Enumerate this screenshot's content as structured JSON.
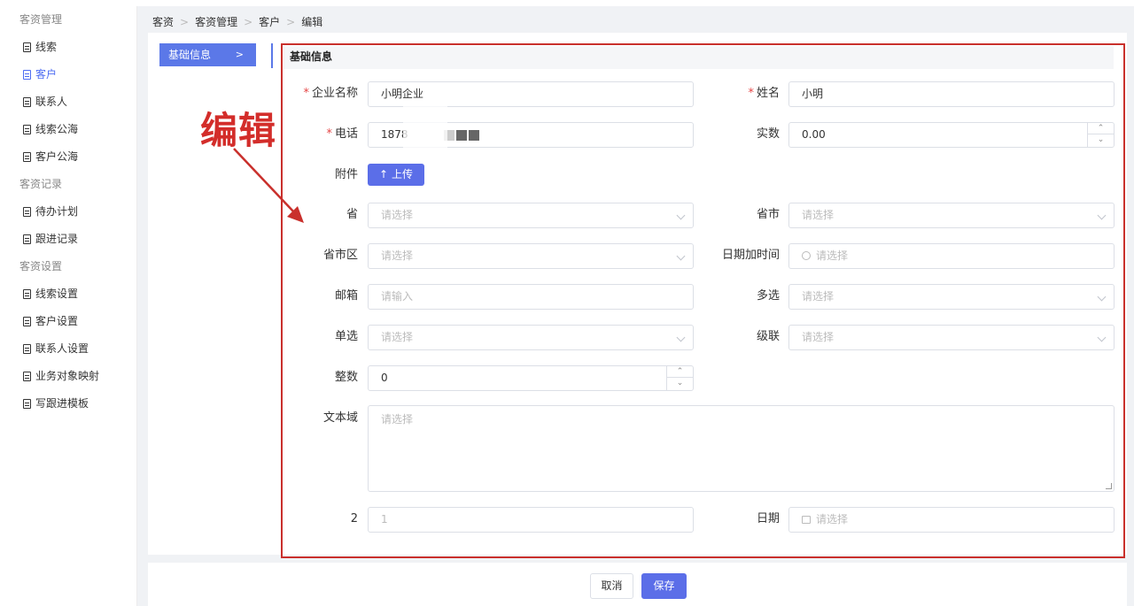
{
  "sidebar": {
    "groups": [
      {
        "label": "客资管理",
        "items": [
          {
            "label": "线索"
          },
          {
            "label": "客户",
            "active": true
          },
          {
            "label": "联系人"
          },
          {
            "label": "线索公海"
          },
          {
            "label": "客户公海"
          }
        ]
      },
      {
        "label": "客资记录",
        "items": [
          {
            "label": "待办计划"
          },
          {
            "label": "跟进记录"
          }
        ]
      },
      {
        "label": "客资设置",
        "items": [
          {
            "label": "线索设置"
          },
          {
            "label": "客户设置"
          },
          {
            "label": "联系人设置"
          },
          {
            "label": "业务对象映射"
          },
          {
            "label": "写跟进模板"
          }
        ]
      }
    ]
  },
  "breadcrumb": [
    "客资",
    "客资管理",
    "客户",
    "编辑"
  ],
  "left_nav": {
    "label": "基础信息",
    "arrow": ">"
  },
  "section_title": "基础信息",
  "annotation": "编辑",
  "form": {
    "company": {
      "label": "企业名称",
      "value": "小明企业"
    },
    "name": {
      "label": "姓名",
      "value": "小明"
    },
    "phone": {
      "label": "电话",
      "value": "1878"
    },
    "real_number": {
      "label": "实数",
      "value": "0.00"
    },
    "attachment": {
      "label": "附件",
      "button": "上传"
    },
    "province": {
      "label": "省",
      "placeholder": "请选择"
    },
    "province_city": {
      "label": "省市",
      "placeholder": "请选择"
    },
    "province_city_district": {
      "label": "省市区",
      "placeholder": "请选择"
    },
    "datetime": {
      "label": "日期加时间",
      "placeholder": "请选择"
    },
    "email": {
      "label": "邮箱",
      "placeholder": "请输入"
    },
    "multi": {
      "label": "多选",
      "placeholder": "请选择"
    },
    "single": {
      "label": "单选",
      "placeholder": "请选择"
    },
    "cascade": {
      "label": "级联",
      "placeholder": "请选择"
    },
    "integer": {
      "label": "整数",
      "value": "0"
    },
    "textarea": {
      "label": "文本域",
      "placeholder": "请选择"
    },
    "field2": {
      "label": "2",
      "placeholder": "1"
    },
    "date": {
      "label": "日期",
      "placeholder": "请选择"
    }
  },
  "buttons": {
    "cancel": "取消",
    "save": "保存"
  },
  "colors": {
    "accent": "#5b6ee8",
    "annotation": "#c9302c",
    "required": "#e54545"
  }
}
